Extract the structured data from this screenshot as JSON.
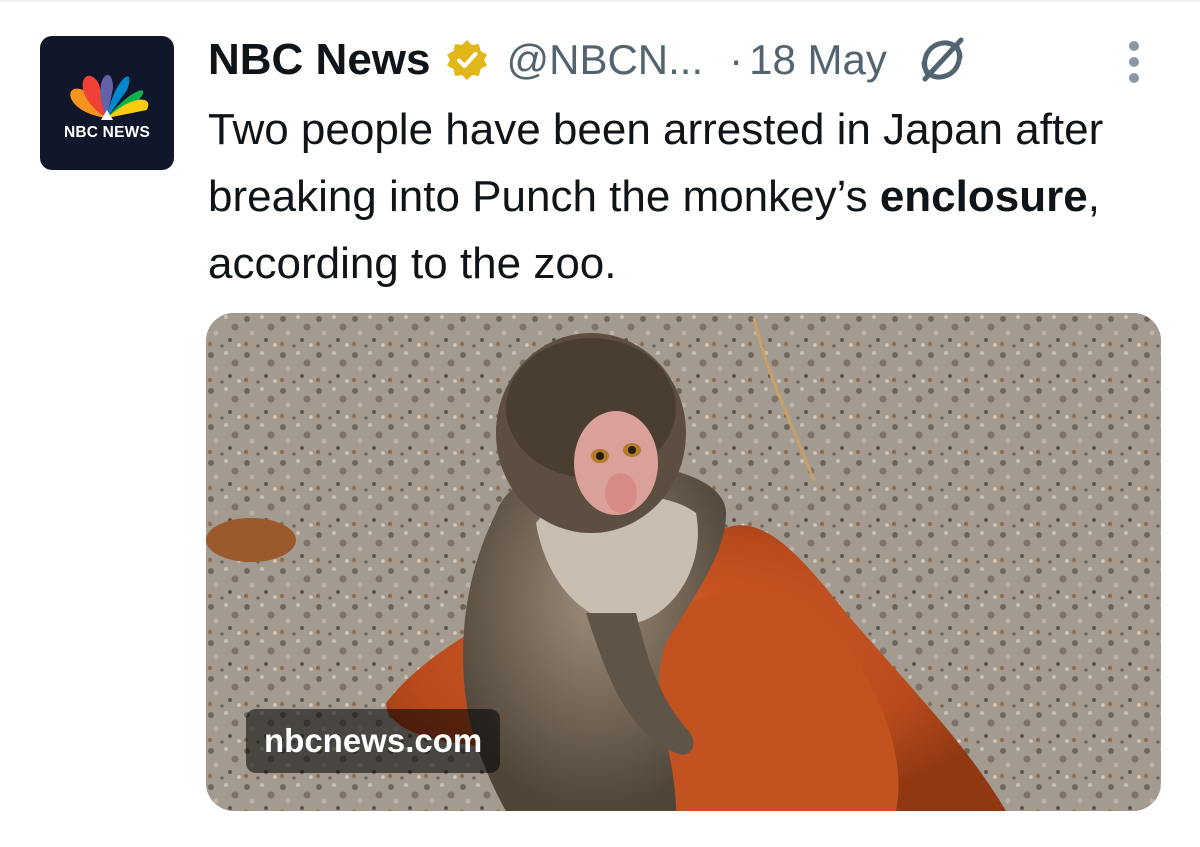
{
  "tweet": {
    "author_name": "NBC News",
    "handle": "@NBCN...",
    "separator": "·",
    "date": "18 May",
    "text_part1": "Two people have been arrested in Japan after breaking into Punch the monkey’s ",
    "text_bold": "enclosure",
    "text_part2": ", according to the zoo.",
    "verified": true
  },
  "avatar": {
    "label": "NBC NEWS",
    "background": "#10172a",
    "peacock_colors": [
      "#fccc12",
      "#ef4136",
      "#6460aa",
      "#0089d0",
      "#0db14b",
      "#f7941d"
    ]
  },
  "media": {
    "source_label": "nbcnews.com",
    "subject": "baby-monkey-with-orange-plush"
  },
  "icons": {
    "verified": "verified-badge-icon",
    "grok": "grok-icon",
    "more": "more-vertical-icon"
  },
  "colors": {
    "text": "#0f1419",
    "muted": "#536471",
    "verified_gold": "#e2b719"
  }
}
